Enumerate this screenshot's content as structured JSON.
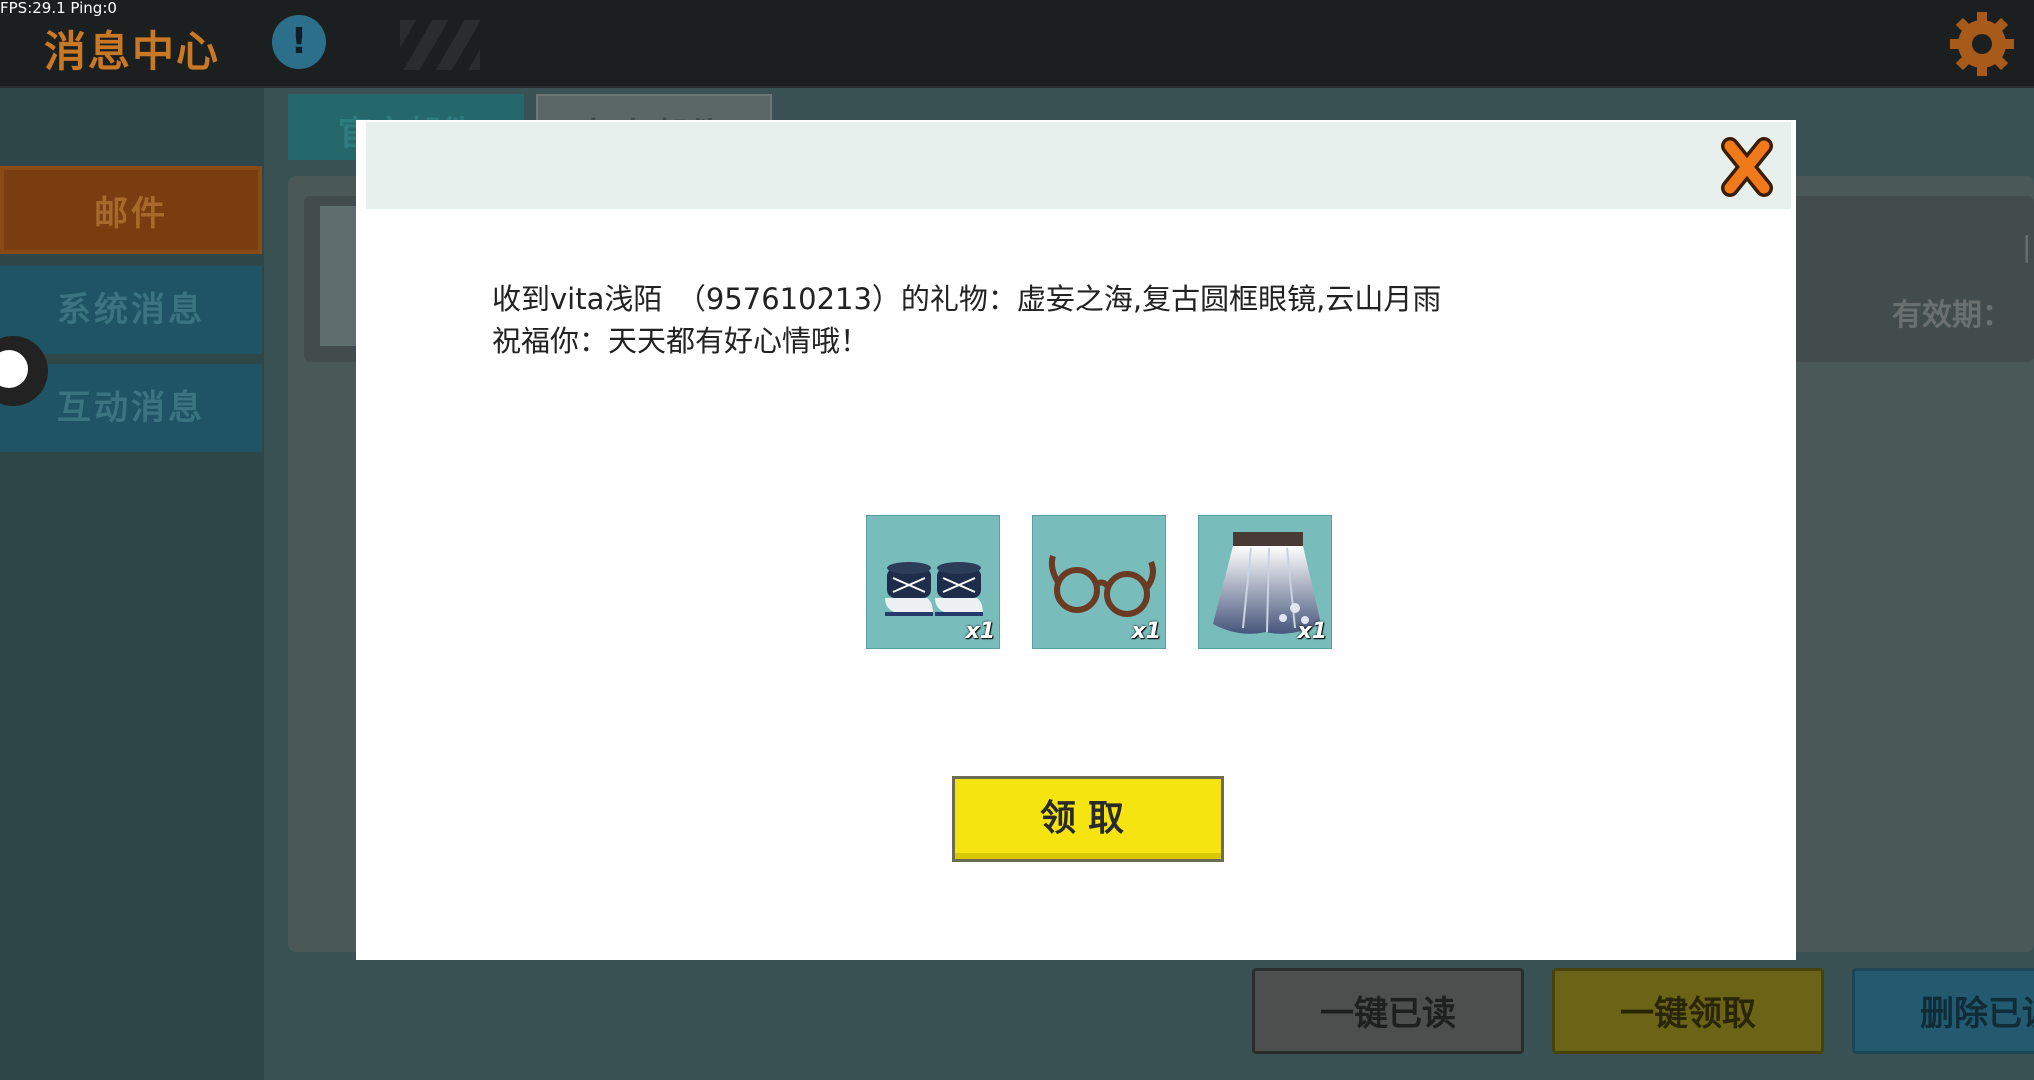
{
  "debug": {
    "fps_text": "FPS:29.1  Ping:0"
  },
  "header": {
    "title": "消息中心",
    "info_icon": "!"
  },
  "sidebar": {
    "items": [
      {
        "label": "邮件"
      },
      {
        "label": "系统消息"
      },
      {
        "label": "互动消息"
      }
    ]
  },
  "tabs": [
    {
      "label": "官方邮件"
    },
    {
      "label": "好友邮件"
    }
  ],
  "mail_card": {
    "expire_label": "有效期：",
    "right_fragment": "|"
  },
  "bottom_buttons": {
    "mark_all_read": "一键已读",
    "claim_all": "一键领取",
    "delete_read": "删除已读"
  },
  "modal": {
    "message_line1": "收到vita浅陌　（957610213）的礼物：虚妄之海,复古圆框眼镜,云山月雨",
    "message_line2": "祝福你：天天都有好心情哦！",
    "items": [
      {
        "icon": "sneakers-icon",
        "qty": "x1"
      },
      {
        "icon": "round-glasses-icon",
        "qty": "x1"
      },
      {
        "icon": "skirt-icon",
        "qty": "x1"
      }
    ],
    "claim_label": "领取"
  },
  "colors": {
    "accent_orange": "#c97825",
    "claim_yellow": "#f5e40f",
    "overlay_teal": "#3b5254"
  }
}
